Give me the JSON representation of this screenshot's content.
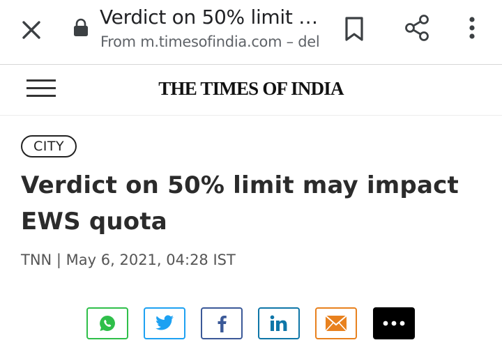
{
  "browser": {
    "page_title": "Verdict on 50% limit …",
    "url_text": "From m.timesofindia.com – del",
    "icons": [
      "close-icon",
      "lock-icon",
      "bookmark-icon",
      "share-icon",
      "more-vert-icon"
    ]
  },
  "site": {
    "logo_text": "THE TIMES OF INDIA"
  },
  "article": {
    "category": "CITY",
    "headline": "Verdict on 50% limit may impact EWS quota",
    "byline": "TNN | May 6, 2021, 04:28 IST"
  },
  "share": {
    "buttons": [
      {
        "name": "whatsapp",
        "icon": "whatsapp-icon",
        "color": "#2fbf4a"
      },
      {
        "name": "twitter",
        "icon": "twitter-icon",
        "color": "#1da1f2"
      },
      {
        "name": "facebook",
        "icon": "facebook-icon",
        "color": "#3b5998"
      },
      {
        "name": "linkedin",
        "icon": "linkedin-icon",
        "color": "#0e76a8"
      },
      {
        "name": "email",
        "icon": "mail-icon",
        "color": "#e8811e"
      },
      {
        "name": "more",
        "icon": "more-horiz-icon",
        "color": "#000000"
      }
    ]
  }
}
